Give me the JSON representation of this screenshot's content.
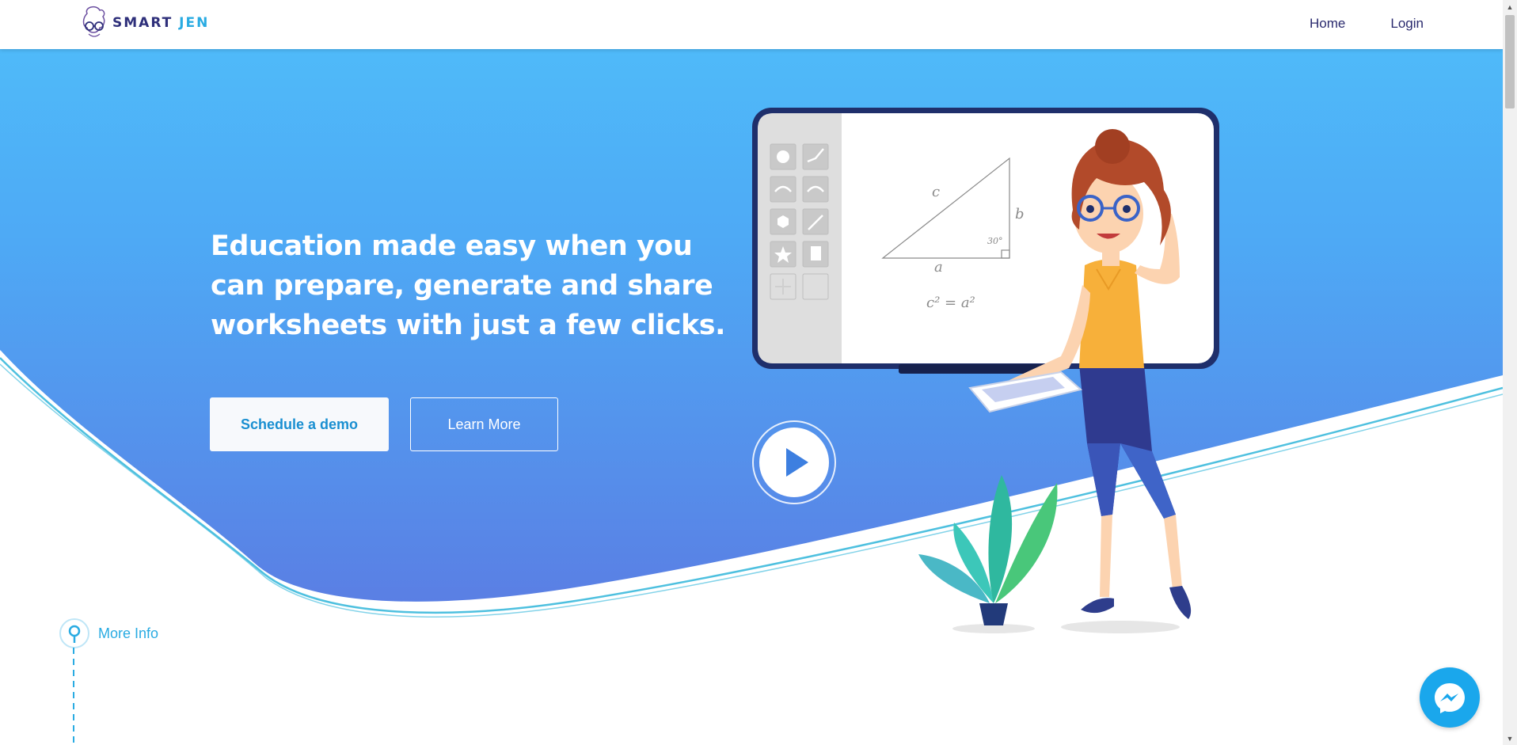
{
  "header": {
    "logo_smart": "SMART",
    "logo_jen": "JEN",
    "nav": [
      {
        "label": "Home"
      },
      {
        "label": "Login"
      }
    ]
  },
  "hero": {
    "headline": "Education made easy when you can prepare, generate and share worksheets with just a few clicks.",
    "demo_button": "Schedule a demo",
    "learn_button": "Learn More"
  },
  "more_info": "More Info",
  "colors": {
    "hero_top": "#4fbaf9",
    "hero_bottom": "#5b80e6",
    "accent": "#29abe2",
    "brand_dark": "#2e2f7a"
  },
  "icons": [
    "logo-icon",
    "play-icon",
    "pin-icon",
    "messenger-icon"
  ]
}
